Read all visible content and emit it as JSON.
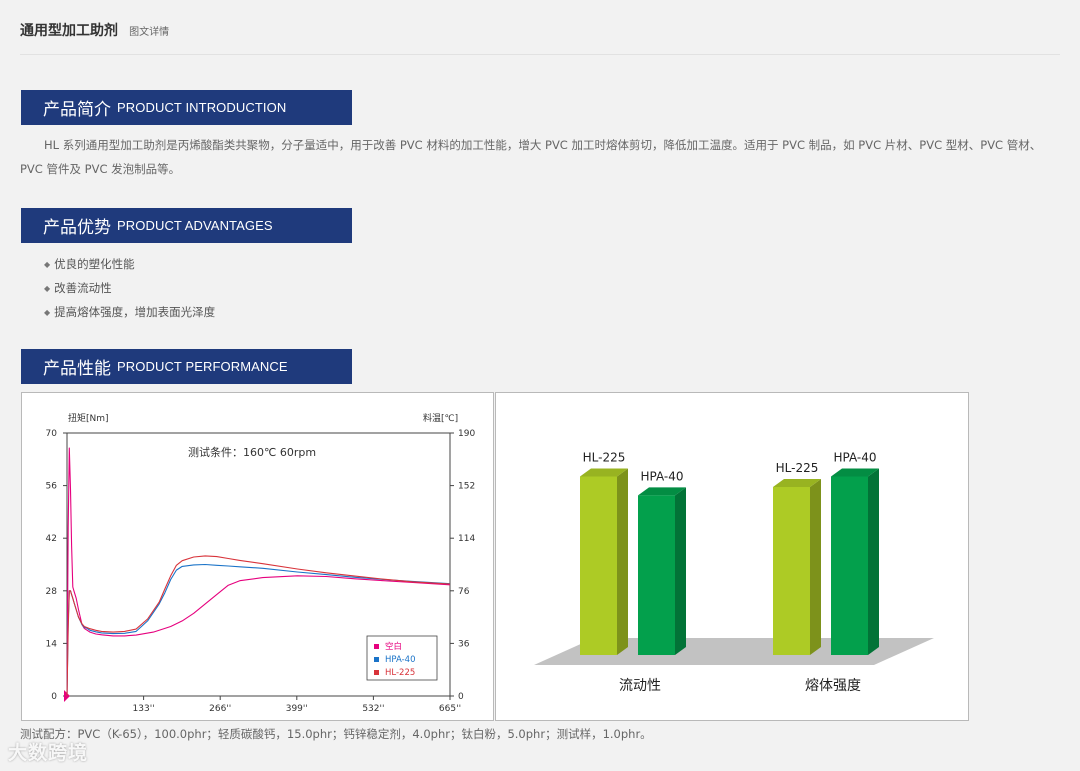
{
  "header": {
    "title": "通用型加工助剂",
    "subtitle": "图文详情"
  },
  "sections": {
    "intro": {
      "title_cn": "产品简介",
      "title_en": "PRODUCT INTRODUCTION"
    },
    "advantages": {
      "title_cn": "产品优势",
      "title_en": "PRODUCT ADVANTAGES"
    },
    "performance": {
      "title_cn": "产品性能",
      "title_en": "PRODUCT PERFORMANCE"
    }
  },
  "intro_text": "HL 系列通用型加工助剂是丙烯酸酯类共聚物，分子量适中，用于改善 PVC 材料的加工性能，增大 PVC 加工时熔体剪切，降低加工温度。适用于 PVC 制品，如 PVC 片材、PVC 型材、PVC 管材、PVC 管件及 PVC 发泡制品等。",
  "advantages": [
    "优良的塑化性能",
    "改善流动性",
    "提高熔体强度，增加表面光泽度"
  ],
  "advantage_bullet": "◆",
  "footnote": "测试配方：PVC（K-65），100.0phr；轻质碳酸钙，15.0phr；钙锌稳定剂，4.0phr；钛白粉，5.0phr；测试样，1.0phr。",
  "watermark": "大数跨境",
  "chart_data": [
    {
      "type": "line",
      "annotation": "测试条件：160℃ 60rpm",
      "ylabel": "扭矩[Nm]",
      "y2label": "料温[℃]",
      "xlim": [
        0,
        665
      ],
      "ylim": [
        0,
        70
      ],
      "y2lim": [
        0,
        190
      ],
      "x_ticks": [
        "133''",
        "266''",
        "399''",
        "532''",
        "665''"
      ],
      "y_ticks": [
        "0",
        "14",
        "28",
        "42",
        "56",
        "70"
      ],
      "y2_ticks": [
        "0",
        "36",
        "76",
        "114",
        "152",
        "190"
      ],
      "grid": false,
      "legend_position": "bottom-right",
      "series": [
        {
          "name": "空白",
          "color": "#e6007e",
          "x": [
            0,
            2,
            4,
            6,
            8,
            10,
            12,
            16,
            20,
            26,
            30,
            35,
            40,
            50,
            60,
            80,
            100,
            120,
            150,
            180,
            200,
            220,
            240,
            260,
            280,
            300,
            340,
            400,
            450,
            500,
            550,
            600,
            665
          ],
          "y": [
            0,
            45,
            66,
            55,
            40,
            29,
            28,
            26,
            23,
            19,
            18,
            17.5,
            17,
            16.5,
            16.3,
            16,
            16,
            16.2,
            17,
            18.5,
            20,
            22,
            24.5,
            27,
            29.5,
            30.7,
            31.5,
            32,
            31.8,
            31.2,
            30.7,
            30.2,
            29.6
          ]
        },
        {
          "name": "HPA-40",
          "color": "#1a73c8",
          "x": [
            0,
            2,
            4,
            6,
            8,
            10,
            12,
            16,
            20,
            26,
            30,
            35,
            40,
            50,
            60,
            80,
            100,
            120,
            140,
            160,
            170,
            180,
            190,
            200,
            220,
            240,
            260,
            280,
            300,
            340,
            400,
            450,
            500,
            550,
            600,
            665
          ],
          "y": [
            0,
            20,
            28,
            28,
            27,
            26,
            25,
            23,
            21,
            19,
            18.3,
            18,
            17.5,
            17.1,
            16.8,
            16.6,
            16.7,
            17.2,
            20,
            24.5,
            27.5,
            31,
            33.5,
            34.5,
            34.9,
            35,
            34.8,
            34.6,
            34.4,
            34,
            33,
            32.3,
            31.6,
            31,
            30.5,
            29.9
          ]
        },
        {
          "name": "HL-225",
          "color": "#d8333a",
          "x": [
            0,
            2,
            4,
            6,
            8,
            10,
            12,
            16,
            20,
            26,
            30,
            35,
            40,
            50,
            60,
            80,
            100,
            120,
            140,
            160,
            170,
            180,
            190,
            200,
            220,
            240,
            260,
            280,
            300,
            340,
            400,
            450,
            500,
            550,
            600,
            665
          ],
          "y": [
            0,
            18,
            28,
            28,
            27,
            26,
            25,
            23,
            21,
            19.2,
            18.5,
            18.2,
            17.9,
            17.5,
            17.2,
            17,
            17.2,
            17.8,
            20.5,
            25,
            28.5,
            32,
            34.8,
            36,
            37,
            37.3,
            37.1,
            36.6,
            36.1,
            35.2,
            33.8,
            32.8,
            31.9,
            31.1,
            30.4,
            29.8
          ]
        }
      ]
    },
    {
      "type": "bar",
      "categories": [
        "流动性",
        "熔体强度"
      ],
      "series": [
        {
          "name": "HL-225",
          "color": "#adcb25",
          "values": [
            85,
            80
          ]
        },
        {
          "name": "HPA-40",
          "color": "#03a04c",
          "values": [
            76,
            85
          ]
        }
      ]
    }
  ]
}
